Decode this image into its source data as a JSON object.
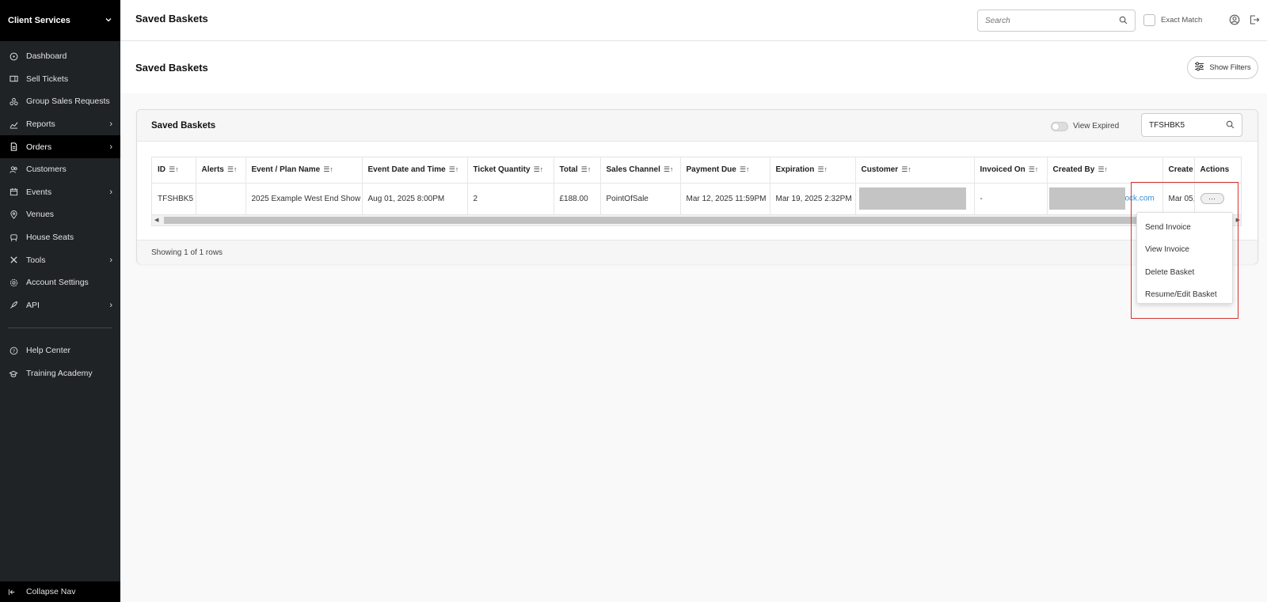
{
  "sidebar": {
    "brand": "Client Services",
    "items": [
      {
        "label": "Dashboard",
        "icon": "gauge-icon",
        "has_children": false,
        "active": false
      },
      {
        "label": "Sell Tickets",
        "icon": "ticket-icon",
        "has_children": false,
        "active": false
      },
      {
        "label": "Group Sales Requests",
        "icon": "group-icon",
        "has_children": false,
        "active": false
      },
      {
        "label": "Reports",
        "icon": "chart-icon",
        "has_children": true,
        "active": false
      },
      {
        "label": "Orders",
        "icon": "document-icon",
        "has_children": true,
        "active": true
      },
      {
        "label": "Customers",
        "icon": "users-icon",
        "has_children": false,
        "active": false
      },
      {
        "label": "Events",
        "icon": "calendar-icon",
        "has_children": true,
        "active": false
      },
      {
        "label": "Venues",
        "icon": "location-pin-icon",
        "has_children": false,
        "active": false
      },
      {
        "label": "House Seats",
        "icon": "seat-icon",
        "has_children": false,
        "active": false
      },
      {
        "label": "Tools",
        "icon": "tools-icon",
        "has_children": true,
        "active": false
      },
      {
        "label": "Account Settings",
        "icon": "gear-icon",
        "has_children": false,
        "active": false
      },
      {
        "label": "API",
        "icon": "rocket-icon",
        "has_children": true,
        "active": false
      }
    ],
    "bottom_items": [
      {
        "label": "Help Center",
        "icon": "question-icon"
      },
      {
        "label": "Training Academy",
        "icon": "graduation-cap-icon"
      }
    ],
    "collapse_label": "Collapse Nav"
  },
  "topbar": {
    "title": "Saved Baskets",
    "search_placeholder": "Search",
    "exact_match_label": "Exact Match"
  },
  "page": {
    "title": "Saved Baskets",
    "show_filters_label": "Show Filters"
  },
  "card": {
    "title": "Saved Baskets",
    "view_expired_label": "View Expired",
    "search_value": "TFSHBK5",
    "footer_text": "Showing 1 of 1 rows"
  },
  "table": {
    "columns": [
      "ID",
      "Alerts",
      "Event / Plan Name",
      "Event Date and Time",
      "Ticket Quantity",
      "Total",
      "Sales Channel",
      "Payment Due",
      "Expiration",
      "Customer",
      "Invoiced On",
      "Created By",
      "Create",
      "Actions"
    ],
    "sort_glyph": "☰↑",
    "row": {
      "id": "TFSHBK5",
      "alerts": "",
      "event_name": "2025 Example West End Show",
      "event_date": "Aug 01, 2025 8:00PM",
      "ticket_quantity": "2",
      "total": "£188.00",
      "sales_channel": "PointOfSale",
      "payment_due": "Mar 12, 2025 11:59PM",
      "expiration": "Mar 19, 2025 2:32PM",
      "customer": "",
      "invoiced_on": "-",
      "created_by_tail": "ock.com",
      "created_on": "Mar 05,",
      "actions_glyph": "···"
    }
  },
  "actions_menu": {
    "items": [
      "Send Invoice",
      "View Invoice",
      "Delete Basket",
      "Resume/Edit Basket"
    ]
  },
  "colors": {
    "sidebar_bg": "#1f2326",
    "sidebar_active_bg": "#000000",
    "link_blue": "#3a8ed0",
    "highlight_red": "#d63333"
  }
}
